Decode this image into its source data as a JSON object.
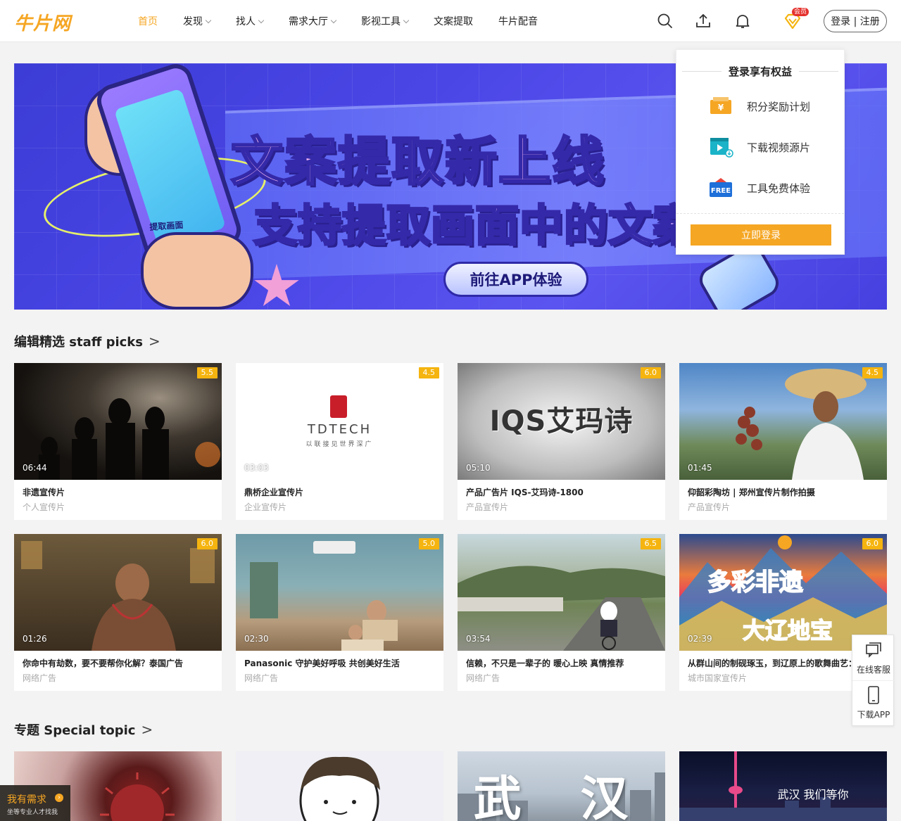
{
  "header": {
    "logo": "牛片网",
    "nav": [
      {
        "label": "首页",
        "active": true,
        "dropdown": false
      },
      {
        "label": "发现",
        "active": false,
        "dropdown": true
      },
      {
        "label": "找人",
        "active": false,
        "dropdown": true
      },
      {
        "label": "需求大厅",
        "active": false,
        "dropdown": true
      },
      {
        "label": "影视工具",
        "active": false,
        "dropdown": true
      },
      {
        "label": "文案提取",
        "active": false,
        "dropdown": false
      },
      {
        "label": "牛片配音",
        "active": false,
        "dropdown": false
      }
    ],
    "vip_badge": "会员",
    "login_label": "登录 | 注册",
    "icons": [
      "search-icon",
      "upload-icon",
      "bell-icon",
      "vip-diamond-icon"
    ]
  },
  "banner": {
    "title_line1": "文案提取新上线",
    "title_line2": "支持提取画面中的文案",
    "cta": "前往APP体验",
    "phone_label": "提取画面"
  },
  "popover": {
    "title": "登录享有权益",
    "items": [
      {
        "label": "积分奖励计划",
        "icon": "coupon-icon",
        "color": "#f5a623"
      },
      {
        "label": "下载视频源片",
        "icon": "video-download-icon",
        "color": "#1ab3c8"
      },
      {
        "label": "工具免费体验",
        "icon": "free-tag-icon",
        "color": "#1e6fd9",
        "badge": "FREE"
      }
    ],
    "login_button": "立即登录"
  },
  "staff_picks": {
    "title": "编辑精选 staff picks",
    "arrow": ">",
    "cards": [
      {
        "title": "非遗宣传片",
        "category": "个人宣传片",
        "rating": "5.5",
        "duration": "06:44",
        "theme": "dark-fire"
      },
      {
        "title": "鼎桥企业宣传片",
        "category": "企业宣传片",
        "rating": "4.5",
        "duration": "03:03",
        "theme": "tdtech",
        "logo_text": "TDTECH",
        "logo_sub": "以联接见世界深广"
      },
      {
        "title": "产品广告片 IQS-艾玛诗-1800",
        "category": "产品宣传片",
        "rating": "6.0",
        "duration": "05:10",
        "theme": "iqs",
        "logo_text": "IQS艾玛诗"
      },
      {
        "title": "仰韶彩陶坊 | 郑州宣传片制作拍摄",
        "category": "产品宣传片",
        "rating": "4.5",
        "duration": "01:45",
        "theme": "farmer"
      },
      {
        "title": "你命中有劫数，要不要帮你化解？泰国广告",
        "category": "网络广告",
        "rating": "6.0",
        "duration": "01:26",
        "theme": "thai"
      },
      {
        "title": "Panasonic 守护美好呼吸 共创美好生活",
        "category": "网络广告",
        "rating": "5.0",
        "duration": "02:30",
        "theme": "living"
      },
      {
        "title": "信赖，不只是一辈子的 暖心上映 真情推荐",
        "category": "网络广告",
        "rating": "6.5",
        "duration": "03:54",
        "theme": "road"
      },
      {
        "title": "从群山间的制砚琢玉，到辽原上的歌舞曲艺：",
        "category": "城市国家宣传片",
        "rating": "6.0",
        "duration": "02:39",
        "theme": "colorful"
      }
    ]
  },
  "special_topic": {
    "title": "专题 Special topic",
    "arrow": ">",
    "items": [
      {
        "theme": "virus"
      },
      {
        "theme": "cartoon"
      },
      {
        "theme": "wuhan",
        "text": "武 汉"
      },
      {
        "theme": "night",
        "text": "武汉 我们等你"
      }
    ]
  },
  "float_panel": {
    "service": "在线客服",
    "app": "下载APP"
  },
  "demand": {
    "title": "我有需求",
    "subtitle": "坐等专业人才找我"
  }
}
